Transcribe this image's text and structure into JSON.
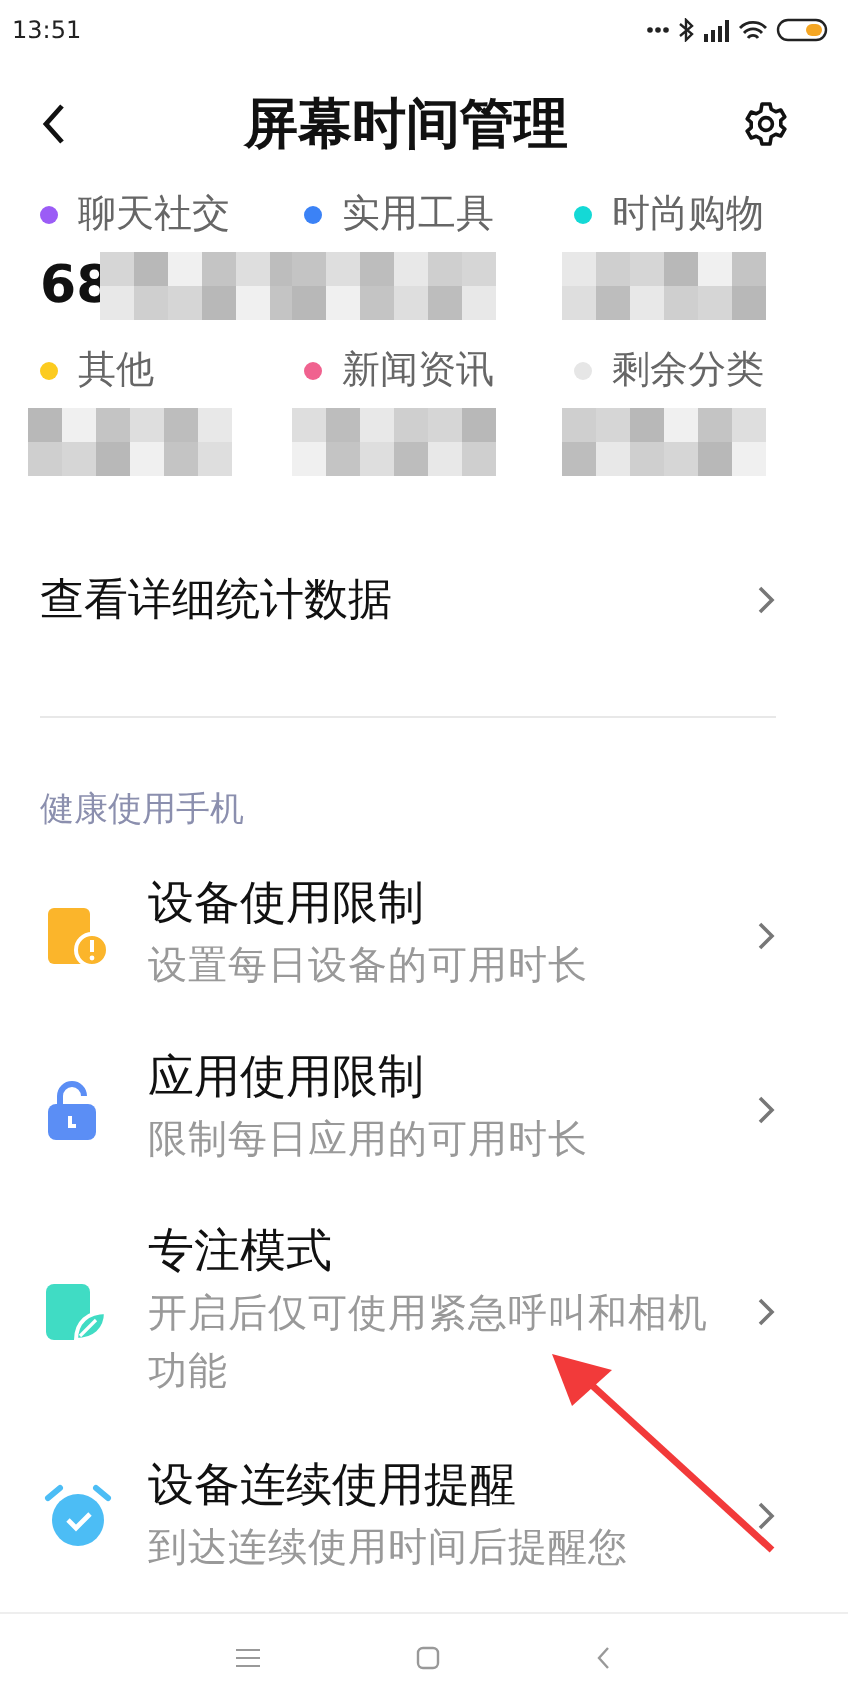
{
  "status_bar": {
    "time": "13:51"
  },
  "header": {
    "title": "屏幕时间管理"
  },
  "categories": [
    {
      "label": "聊天社交",
      "color": "#9b5cf6",
      "value": "68"
    },
    {
      "label": "实用工具",
      "color": "#3b82f6"
    },
    {
      "label": "时尚购物",
      "color": "#14d9d6"
    },
    {
      "label": "其他",
      "color": "#fccb1f"
    },
    {
      "label": "新闻资讯",
      "color": "#f0628f"
    },
    {
      "label": "剩余分类",
      "color": "#e6e6e6"
    }
  ],
  "details_link": {
    "label": "查看详细统计数据"
  },
  "section": {
    "title": "健康使用手机",
    "items": [
      {
        "kind": "device",
        "title": "设备使用限制",
        "subtitle": "设置每日设备的可用时长"
      },
      {
        "kind": "app",
        "title": "应用使用限制",
        "subtitle": "限制每日应用的可用时长"
      },
      {
        "kind": "focus",
        "title": "专注模式",
        "subtitle": "开启后仅可使用紧急呼叫和相机功能"
      },
      {
        "kind": "alarm",
        "title": "设备连续使用提醒",
        "subtitle": "到达连续使用时间后提醒您"
      }
    ]
  }
}
